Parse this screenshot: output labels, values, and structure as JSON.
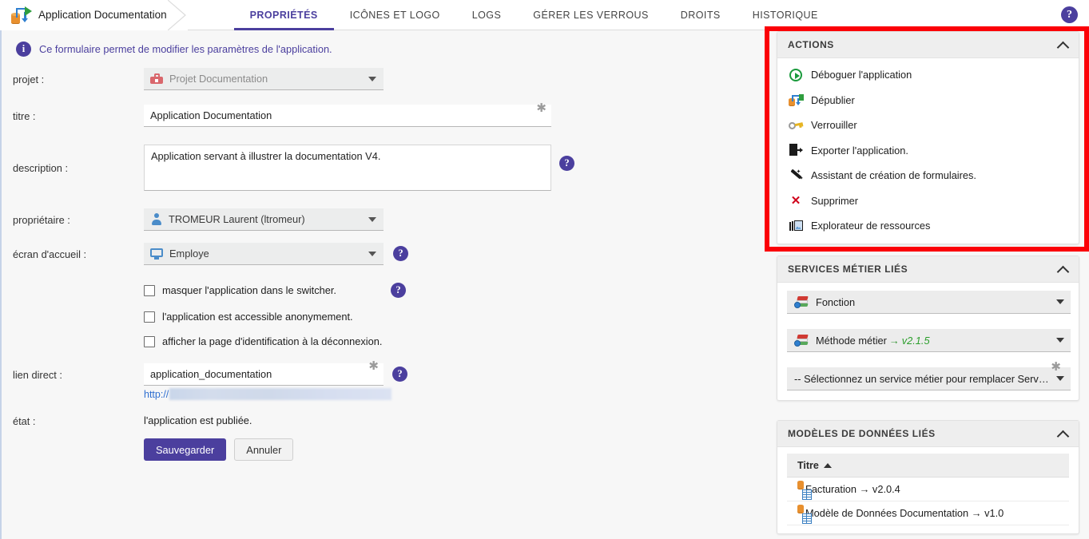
{
  "topbar": {
    "app_icon": "application-publish-icon",
    "title": "Application Documentation",
    "help_icon": "help-circle-icon",
    "tabs": [
      {
        "label": "PROPRIÉTÉS",
        "active": true
      },
      {
        "label": "ICÔNES ET LOGO",
        "active": false
      },
      {
        "label": "LOGS",
        "active": false
      },
      {
        "label": "GÉRER LES VERROUS",
        "active": false
      },
      {
        "label": "DROITS",
        "active": false
      },
      {
        "label": "HISTORIQUE",
        "active": false
      }
    ]
  },
  "form": {
    "info_icon": "info-circle-icon",
    "info_text": "Ce formulaire permet de modifier les paramètres de l'application.",
    "labels": {
      "projet": "projet :",
      "titre": "titre :",
      "description": "description :",
      "proprietaire": "propriétaire :",
      "ecran_accueil": "écran d'accueil :",
      "lien_direct": "lien direct :",
      "etat": "état :"
    },
    "projet_value": "Projet Documentation",
    "projet_icon": "toolbox-icon",
    "titre_value": "Application Documentation",
    "description_value": "Application servant à illustrer la documentation V4.",
    "proprietaire_value": "TROMEUR Laurent (ltromeur)",
    "proprietaire_icon": "person-icon",
    "ecran_accueil_value": "Employe",
    "ecran_accueil_icon": "monitor-icon",
    "checkboxes": [
      {
        "label": "masquer l'application dans le switcher.",
        "checked": false,
        "has_help": true
      },
      {
        "label": "l'application est accessible anonymement.",
        "checked": false,
        "has_help": false
      },
      {
        "label": "afficher la page d'identification à la déconnexion.",
        "checked": false,
        "has_help": false
      }
    ],
    "lien_direct_value": "application_documentation",
    "lien_prefix": "http://",
    "etat_value": "l'application est publiée.",
    "required_marker": "✱",
    "buttons": {
      "save": "Sauvegarder",
      "cancel": "Annuler"
    },
    "accent_color": "#4b3f9e"
  },
  "sidebar": {
    "highlight_color": "#fb0007",
    "actions": {
      "title": "ACTIONS",
      "collapse_icon": "chevron-up-icon",
      "items": [
        {
          "label": "Déboguer l'application",
          "icon": "play-circle-icon"
        },
        {
          "label": "Dépublier",
          "icon": "unpublish-icon"
        },
        {
          "label": "Verrouiller",
          "icon": "key-icon"
        },
        {
          "label": "Exporter l'application.",
          "icon": "export-icon"
        },
        {
          "label": "Assistant de création de formulaires.",
          "icon": "magic-wand-icon"
        },
        {
          "label": "Supprimer",
          "icon": "delete-x-icon"
        },
        {
          "label": "Explorateur de ressources",
          "icon": "gallery-icon"
        }
      ]
    },
    "services": {
      "title": "SERVICES MÉTIER LIÉS",
      "collapse_icon": "chevron-up-icon",
      "items": [
        {
          "label": "Fonction",
          "version": "",
          "icon": "business-service-icon"
        },
        {
          "label": "Méthode métier",
          "version": "v2.1.5",
          "arrow": "→",
          "icon": "business-service-icon"
        }
      ],
      "placeholder": "-- Sélectionnez un service métier pour remplacer Service Mét...",
      "placeholder_required": "✱"
    },
    "datamodels": {
      "title": "MODÈLES DE DONNÉES LIÉS",
      "collapse_icon": "chevron-up-icon",
      "column_header": "Titre",
      "sort_icon": "sort-asc-icon",
      "rows": [
        {
          "label": "Facturation → v2.0.4",
          "icon": "data-model-icon"
        },
        {
          "label": "Modèle de Données Documentation → v1.0",
          "icon": "data-model-icon"
        }
      ]
    }
  }
}
